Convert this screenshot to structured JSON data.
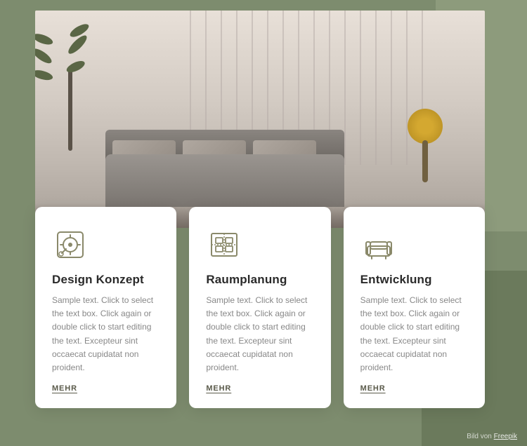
{
  "page": {
    "background_color_main": "#7d8c6e",
    "background_color_accent1": "#8d9b7c",
    "background_color_accent2": "#6b7a5c"
  },
  "attribution": {
    "prefix": "Bild von",
    "link_text": "Freepik"
  },
  "cards": [
    {
      "id": "design-konzept",
      "icon_name": "design-concept-icon",
      "title": "Design Konzept",
      "text": "Sample text. Click to select the text box. Click again or double click to start editing the text. Excepteur sint occaecat cupidatat non proident.",
      "link_label": "MEHR"
    },
    {
      "id": "raumplanung",
      "icon_name": "room-planning-icon",
      "title": "Raumplanung",
      "text": "Sample text. Click to select the text box. Click again or double click to start editing the text. Excepteur sint occaecat cupidatat non proident.",
      "link_label": "MEHR"
    },
    {
      "id": "entwicklung",
      "icon_name": "development-icon",
      "title": "Entwicklung",
      "text": "Sample text. Click to select the text box. Click again or double click to start editing the text. Excepteur sint occaecat cupidatat non proident.",
      "link_label": "MEHR"
    }
  ]
}
